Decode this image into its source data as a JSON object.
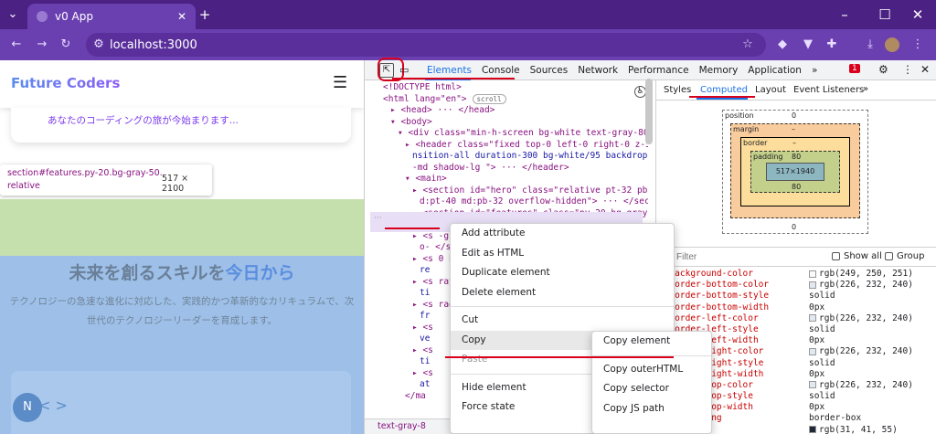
{
  "browser": {
    "tab_title": "v0 App",
    "url": "localhost:3000"
  },
  "site": {
    "brand": "Future Coders",
    "hero_sub": "あなたのコーディングの旅が今始まります...",
    "tooltip_sel": "section#features.py-20.bg-gray-50.",
    "tooltip_sel2": "relative",
    "tooltip_size": "517 × 2100",
    "heading_a": "未来を創るスキルを",
    "heading_b": "今日から",
    "para": "テクノロジーの急速な進化に対応した、実践的かつ革新的なカリキュラムで、次世代のテクノロジーリーダーを育成します。",
    "avatar": "N",
    "arrows": "< >"
  },
  "devtools": {
    "tabs": [
      "Elements",
      "Console",
      "Sources",
      "Network",
      "Performance",
      "Memory",
      "Application"
    ],
    "more": "»",
    "badge": "1",
    "lines": [
      {
        "i": 0,
        "t": "<!DOCTYPE html>"
      },
      {
        "i": 0,
        "t": "<html lang=\"en\">",
        "b": "scroll"
      },
      {
        "i": 1,
        "t": "▸ <head> ··· </head>"
      },
      {
        "i": 1,
        "t": "▾ <body>"
      },
      {
        "i": 2,
        "t": "▾ <div class=\"min-h-screen bg-white text-gray-800\">"
      },
      {
        "i": 3,
        "t": "▸ <header class=\"fixed top-0 left-0 right-0 z-50 tra"
      },
      {
        "i": 4,
        "t": "nsition-all duration-300 bg-white/95 backdrop-blur"
      },
      {
        "i": 4,
        "t": "-md shadow-lg \"> ··· </header>"
      },
      {
        "i": 3,
        "t": "▾ <main>"
      },
      {
        "i": 4,
        "t": "▸ <section id=\"hero\" class=\"relative pt-32 pb-20 m"
      },
      {
        "i": 5,
        "t": "d:pt-40 md:pb-32 overflow-hidden\"> ··· </section>"
      },
      {
        "i": 4,
        "t": "▸ <section id=\"features\" class=\"py-20 bg-gray-50 r"
      },
      {
        "i": 5,
        "t": "elative\"> ··· </section>"
      },
      {
        "i": 4,
        "t": "▸ <s                  -gradient-t"
      },
      {
        "i": 5,
        "t": "o-                   </section>"
      },
      {
        "i": 4,
        "t": "▸ <s                 0 bg-white"
      },
      {
        "i": 5,
        "t": "re"
      },
      {
        "i": 4,
        "t": "▸ <s                 ray-50 rela"
      },
      {
        "i": 5,
        "t": "ti"
      },
      {
        "i": 4,
        "t": "▸ <s                 radient-to-b"
      },
      {
        "i": 5,
        "t": "fr"
      },
      {
        "i": 4,
        "t": "▸ <s"
      },
      {
        "i": 5,
        "t": "ve"
      },
      {
        "i": 4,
        "t": "▸ <s"
      },
      {
        "i": 5,
        "t": "ti"
      },
      {
        "i": 4,
        "t": "▸ <s"
      },
      {
        "i": 5,
        "t": "at"
      },
      {
        "i": 3,
        "t": "</ma"
      }
    ],
    "crumb": "text-gray-8",
    "side_tabs": [
      "Styles",
      "Computed",
      "Layout",
      "Event Listeners"
    ],
    "box": {
      "position": "position",
      "pos_val": "0",
      "margin": "margin",
      "margin_val": "–",
      "border": "border",
      "border_val": "–",
      "padding": "padding",
      "pad_val": "80",
      "content": "517×1940",
      "side0": "0"
    },
    "filter_placeholder": "Filter",
    "show_all": "Show all",
    "group": "Group",
    "props": [
      {
        "n": "background-color",
        "v": "rgb(249, 250, 251)",
        "c": "#f9fafb"
      },
      {
        "n": "border-bottom-color",
        "v": "rgb(226, 232, 240)",
        "c": "#e2e8f0"
      },
      {
        "n": "border-bottom-style",
        "v": "solid"
      },
      {
        "n": "border-bottom-width",
        "v": "0px"
      },
      {
        "n": "border-left-color",
        "v": "rgb(226, 232, 240)",
        "c": "#e2e8f0"
      },
      {
        "n": "border-left-style",
        "v": "solid"
      },
      {
        "n": "border-left-width",
        "v": "0px"
      },
      {
        "n": "border-right-color",
        "v": "rgb(226, 232, 240)",
        "c": "#e2e8f0"
      },
      {
        "n": "border-right-style",
        "v": "solid"
      },
      {
        "n": "border-right-width",
        "v": "0px"
      },
      {
        "n": "border-top-color",
        "v": "rgb(226, 232, 240)",
        "c": "#e2e8f0"
      },
      {
        "n": "border-top-style",
        "v": "solid"
      },
      {
        "n": "border-top-width",
        "v": "0px"
      },
      {
        "n": "box-sizing",
        "v": "border-box"
      },
      {
        "n": "color",
        "v": "rgb(31, 41, 55)",
        "c": "#1f2937"
      }
    ],
    "menu1": [
      "Add attribute",
      "Edit as HTML",
      "Duplicate element",
      "Delete element",
      "",
      "Cut",
      "Copy",
      "Paste",
      "",
      "Hide element",
      "Force state"
    ],
    "menu2": [
      "Copy element",
      "",
      "Copy outerHTML",
      "Copy selector",
      "Copy JS path"
    ]
  }
}
